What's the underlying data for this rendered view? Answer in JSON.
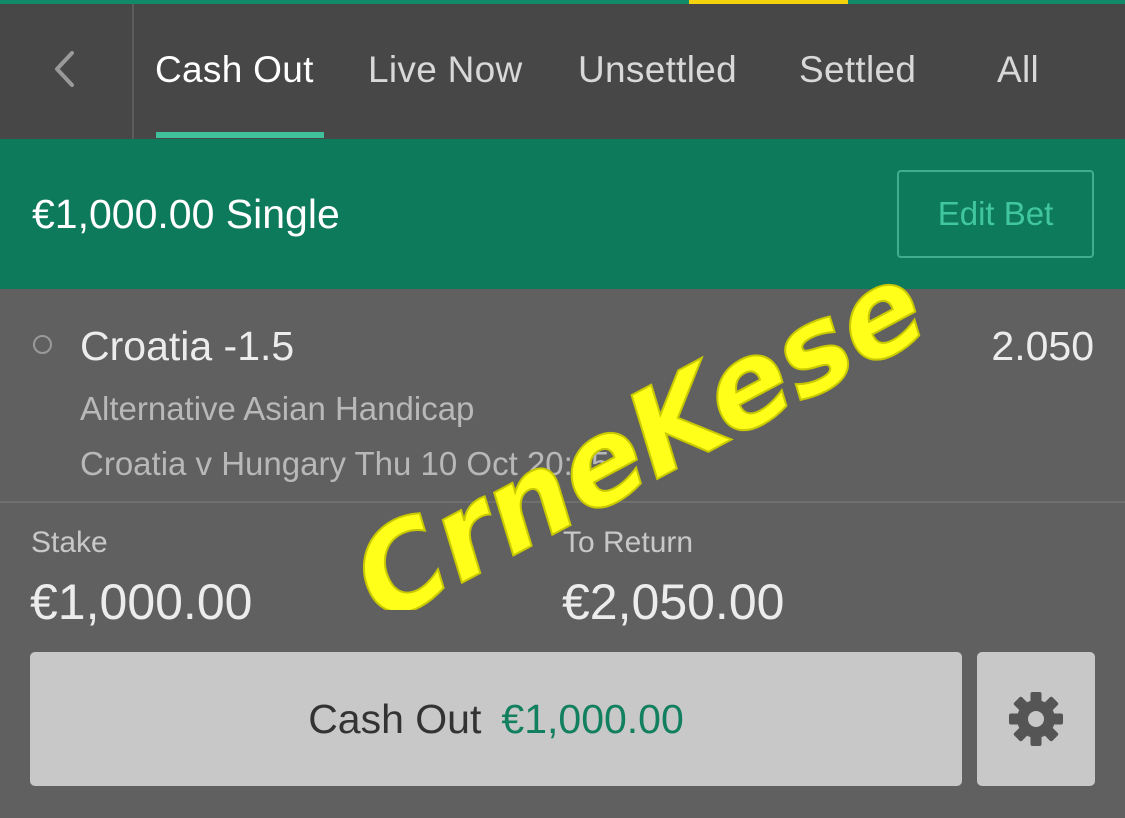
{
  "nav": {
    "tabs": [
      {
        "label": "Cash Out",
        "active": true
      },
      {
        "label": "Live Now",
        "active": false
      },
      {
        "label": "Unsettled",
        "active": false
      },
      {
        "label": "Settled",
        "active": false
      },
      {
        "label": "All",
        "active": false
      }
    ],
    "icons": {
      "back": "chevron-left-icon"
    }
  },
  "bet": {
    "title": "€1,000.00 Single",
    "edit_label": "Edit Bet",
    "selection": {
      "name": "Croatia -1.5",
      "odds": "2.050",
      "market": "Alternative Asian Handicap",
      "event": "Croatia v Hungary Thu 10 Oct 20:45"
    },
    "stake_label": "Stake",
    "stake_value": "€1,000.00",
    "return_label": "To Return",
    "return_value": "€2,050.00",
    "cashout_label": "Cash Out",
    "cashout_value": "€1,000.00",
    "settings_icon": "gear-icon"
  },
  "watermark": {
    "text": "CrneKese",
    "color": "#ffff1a"
  },
  "colors": {
    "accent": "#0e7a5c",
    "accent_light": "#3fbf9a",
    "nav_bg": "#474747",
    "body_bg": "#606060",
    "highlight_yellow": "#f5d20b"
  }
}
